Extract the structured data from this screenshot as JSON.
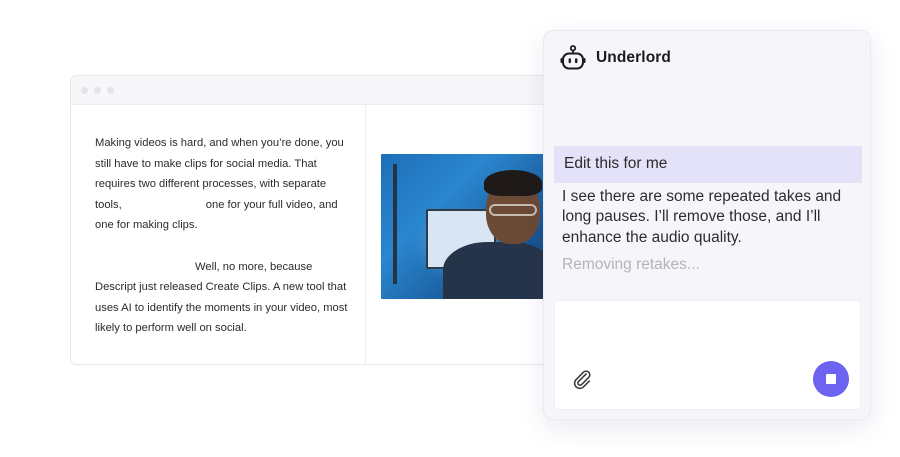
{
  "editor": {
    "transcript": {
      "paragraph_1": {
        "line_1": "Making videos is hard, and when you’re done, you",
        "line_2": "still have to make clips for social media. That",
        "line_3": "requires two different processes, with separate",
        "line_4a": "tools,",
        "line_4b": "one for your full video, and",
        "line_5": "one for making clips."
      },
      "paragraph_2": {
        "line_1": "Well, no more, because",
        "line_2": "Descript just released Create Clips. A new tool that",
        "line_3": "uses AI to identify the moments in your video, most",
        "line_4": "likely to perform well on social."
      }
    }
  },
  "assistant": {
    "title": "Underlord",
    "icon": "robot-icon",
    "user_message": "Edit this for me",
    "reply": "I see there are some repeated takes and long pauses. I’ll remove those, and I’ll enhance the audio quality.",
    "status": "Removing retakes...",
    "input": {
      "value": "",
      "attach_icon": "paperclip-icon",
      "stop_icon": "stop-icon"
    },
    "colors": {
      "accent": "#6c63f0",
      "user_bubble": "#e4e2f9",
      "panel_bg": "#f6f5fa"
    }
  }
}
